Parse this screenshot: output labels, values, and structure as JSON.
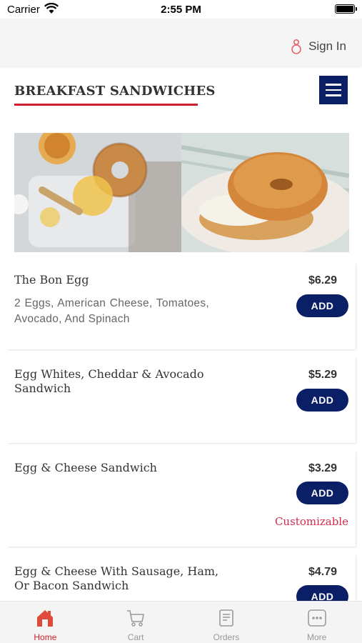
{
  "status_bar": {
    "carrier": "Carrier",
    "time": "2:55 PM"
  },
  "header": {
    "sign_in_label": "Sign In"
  },
  "section": {
    "title": "BREAKFAST SANDWICHES"
  },
  "items": [
    {
      "name": "The Bon Egg",
      "description": "2 Eggs, American Cheese, Tomatoes, Avocado, And Spinach",
      "price": "$6.29",
      "add_label": "ADD"
    },
    {
      "name": "Egg Whites, Cheddar & Avocado Sandwich",
      "price": "$5.29",
      "add_label": "ADD"
    },
    {
      "name": "Egg & Cheese Sandwich",
      "price": "$3.29",
      "add_label": "ADD",
      "note": "Customizable"
    },
    {
      "name": "Egg & Cheese With Sausage, Ham, Or Bacon Sandwich",
      "price": "$4.79",
      "add_label": "ADD"
    }
  ],
  "tabs": [
    {
      "label": "Home",
      "icon": "home-icon",
      "active": true
    },
    {
      "label": "Cart",
      "icon": "cart-icon"
    },
    {
      "label": "Orders",
      "icon": "orders-icon"
    },
    {
      "label": "More",
      "icon": "more-icon"
    }
  ],
  "colors": {
    "primary": "#0b1f66",
    "accent": "#d0202e",
    "customizable": "#d42a4f"
  }
}
